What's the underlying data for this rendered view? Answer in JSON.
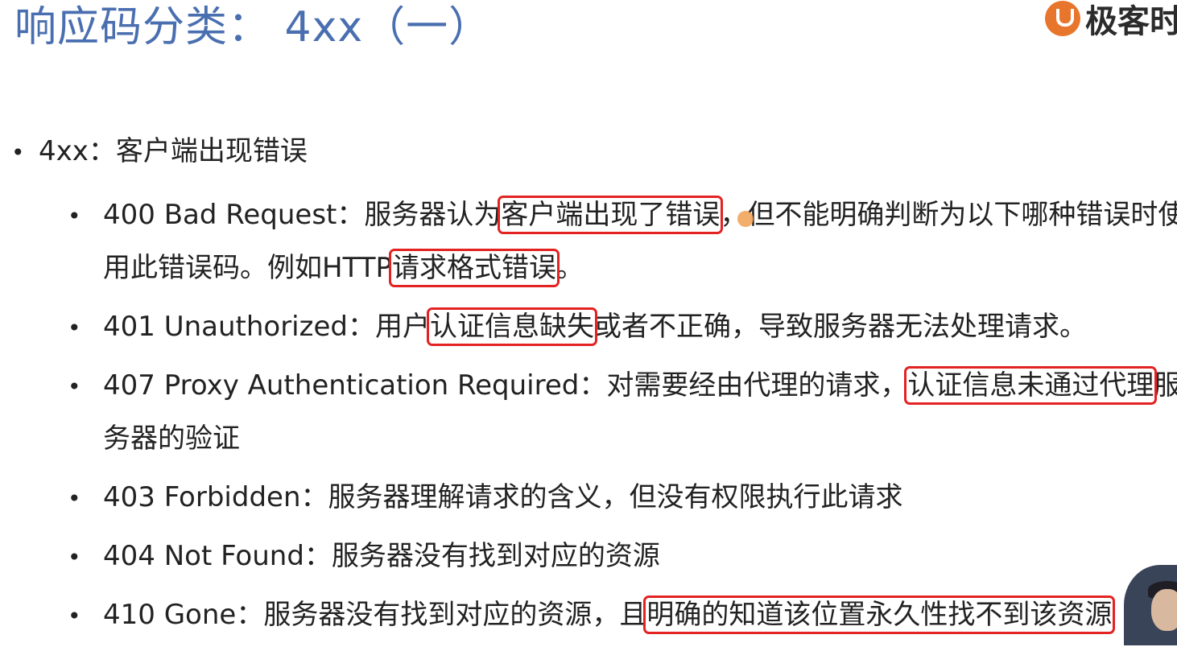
{
  "slide": {
    "title": "响应码分类： 4xx（一）",
    "logo_text": "极客时",
    "section": {
      "code": "4xx",
      "sep": "：",
      "desc": "客户端出现错误"
    },
    "items": [
      {
        "code": "400 Bad Request",
        "sep": "：",
        "p1": "服务器认为",
        "h1": "客户端出现了错误",
        "p2": "，但不能明确判断为以下哪种错误时使用此错误码。例如HTTP",
        "h2": "请求格式错误",
        "p3": "。"
      },
      {
        "code": "401 Unauthorized",
        "sep": "：",
        "p1": "用户",
        "h1": "认证信息缺失",
        "p2": "或者不正确，导致服务器无法处理请求。"
      },
      {
        "code": "407 Proxy Authentication Required",
        "sep": "：",
        "p1": "对需要经由代理的请求，",
        "h1": "认证信息未通过代理",
        "p2": "服务器的验证"
      },
      {
        "code": "403 Forbidden",
        "sep": "：",
        "p1": "服务器理解请求的含义，但没有权限执行此请求"
      },
      {
        "code": "404 Not Found",
        "sep": "：",
        "p1": "服务器没有找到对应的资源"
      },
      {
        "code": "410 Gone",
        "sep": "：",
        "p1": "服务器没有找到对应的资源，且",
        "h1": "明确的知道该位置永久性找不到该资源"
      }
    ]
  },
  "colors": {
    "title": "#4a6fb0",
    "highlight_border": "#e32222",
    "logo_accent": "#e8752c"
  },
  "icons": {
    "logo": "geekbang-logo-icon",
    "cursor": "pointer-dot-icon",
    "presenter": "presenter-avatar"
  }
}
